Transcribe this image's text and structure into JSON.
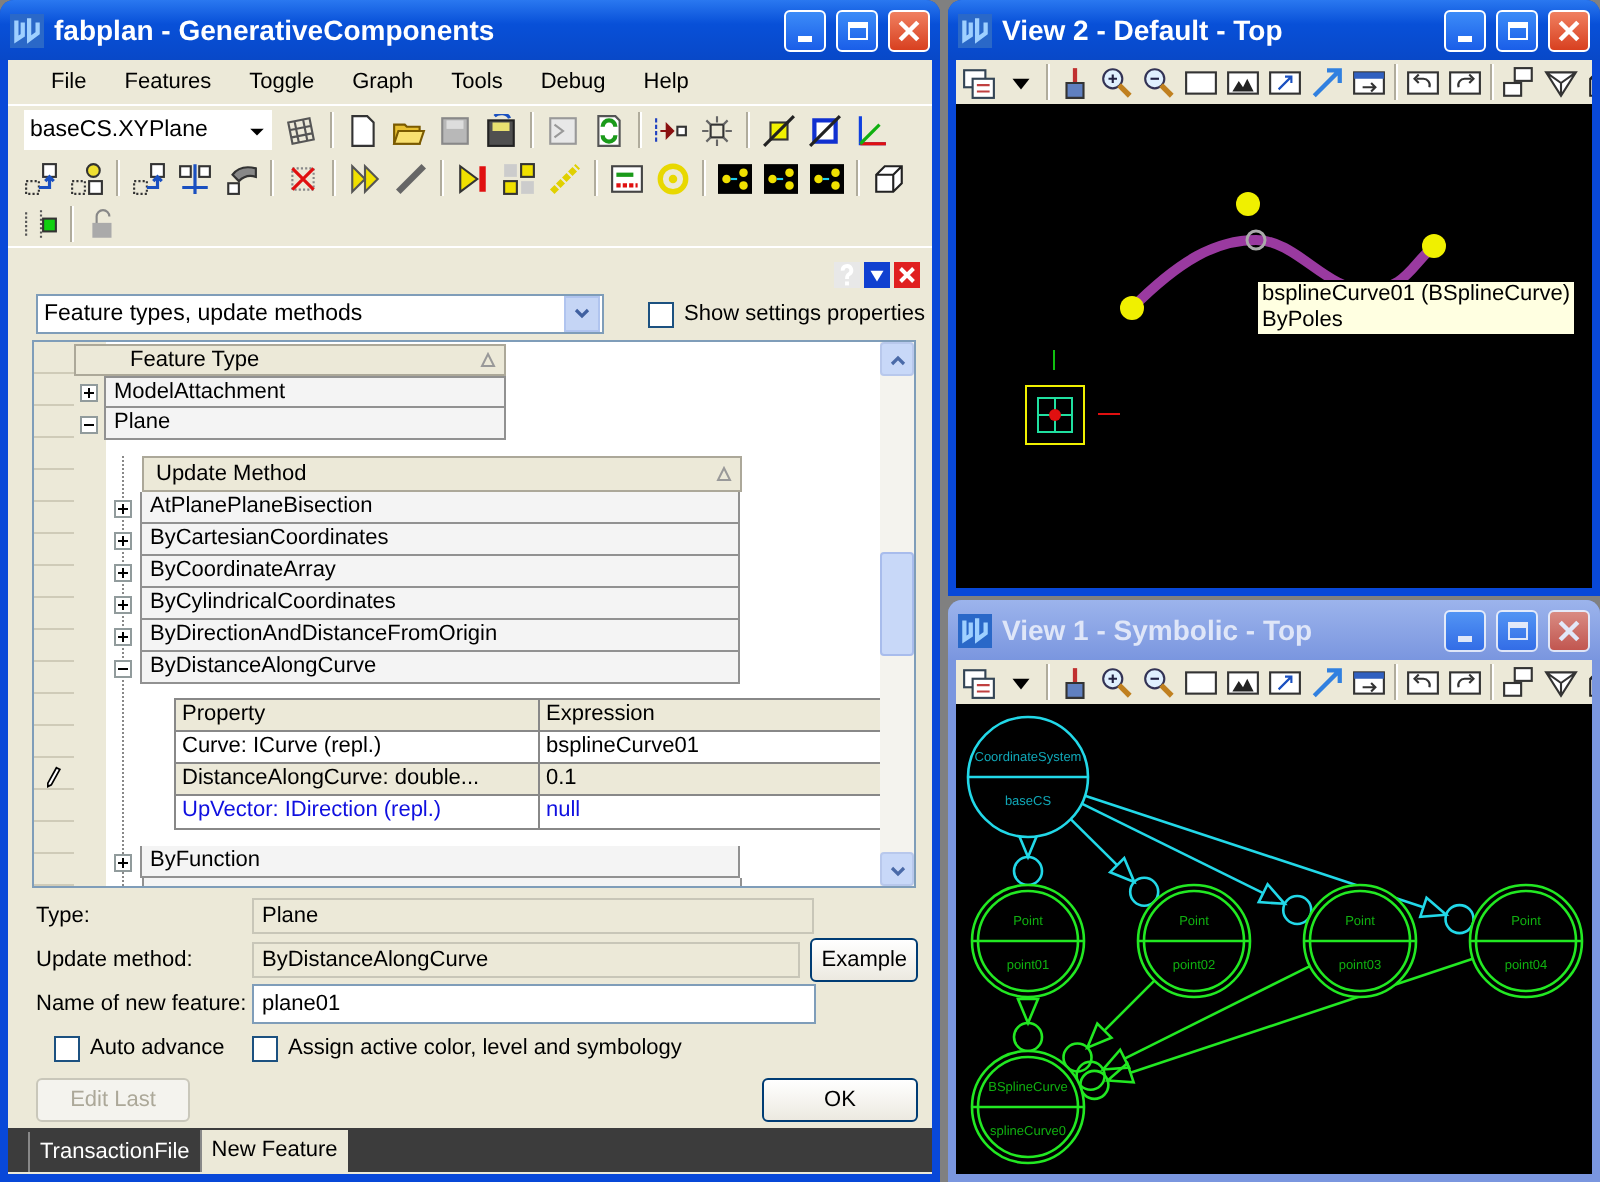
{
  "main_window": {
    "title": "fabplan - GenerativeComponents",
    "active": true,
    "menu": [
      "File",
      "Features",
      "Toggle",
      "Graph",
      "Tools",
      "Debug",
      "Help"
    ],
    "plane_select": {
      "value": "baseCS.XYPlane"
    },
    "view_select": {
      "value": "Feature types, update methods"
    },
    "show_settings": {
      "label": "Show settings properties",
      "checked": false
    },
    "feature_tree": {
      "column": "Feature Type",
      "items": [
        {
          "label": "ModelAttachment",
          "expanded": false
        },
        {
          "label": "Plane",
          "expanded": true,
          "column": "Update Method",
          "children": [
            {
              "label": "AtPlanePlaneBisection",
              "expanded": false
            },
            {
              "label": "ByCartesianCoordinates",
              "expanded": false
            },
            {
              "label": "ByCoordinateArray",
              "expanded": false
            },
            {
              "label": "ByCylindricalCoordinates",
              "expanded": false
            },
            {
              "label": "ByDirectionAndDistanceFromOrigin",
              "expanded": false
            },
            {
              "label": "ByDistanceAlongCurve",
              "expanded": true,
              "properties": {
                "columns": [
                  "Property",
                  "Expression"
                ],
                "rows": [
                  {
                    "property": "Curve: ICurve (repl.)",
                    "expression": "bsplineCurve01",
                    "selected": false,
                    "optional": false
                  },
                  {
                    "property": "DistanceAlongCurve:  double...",
                    "expression": "0.1",
                    "selected": true,
                    "optional": false
                  },
                  {
                    "property": "UpVector: IDirection (repl.)",
                    "expression": "null",
                    "selected": false,
                    "optional": true
                  }
                ]
              }
            },
            {
              "label": "ByFunction",
              "expanded": false
            }
          ]
        }
      ]
    },
    "form": {
      "type_label": "Type:",
      "type_value": "Plane",
      "method_label": "Update method:",
      "method_value": "ByDistanceAlongCurve",
      "name_label": "Name of new feature:",
      "name_value": "plane01",
      "auto_advance": {
        "label": "Auto advance",
        "checked": false
      },
      "assign_active": {
        "label": "Assign active color, level and symbology",
        "checked": false
      },
      "example_button": "Example",
      "edit_last_button": {
        "label": "Edit Last",
        "disabled": true
      },
      "ok_button": "OK"
    },
    "tabs": [
      {
        "label": "TransactionFile",
        "selected": false
      },
      {
        "label": "New Feature",
        "selected": true
      }
    ]
  },
  "view_2": {
    "title": "View 2 - Default - Top",
    "active": true,
    "tooltip": [
      "bsplineCurve01 (BSplineCurve)",
      "ByPoles"
    ]
  },
  "view_1": {
    "title": "View 1 - Symbolic - Top",
    "active": false,
    "nodes": [
      {
        "kind": "coordinate",
        "type": "CoordinateSystem",
        "name": "baseCS"
      },
      {
        "kind": "point",
        "type": "Point",
        "name": "point01"
      },
      {
        "kind": "point",
        "type": "Point",
        "name": "point02"
      },
      {
        "kind": "point",
        "type": "Point",
        "name": "point03"
      },
      {
        "kind": "point",
        "type": "Point",
        "name": "point04"
      },
      {
        "kind": "curve",
        "type": "BSplineCurve",
        "name": "splineCurve0"
      }
    ]
  }
}
